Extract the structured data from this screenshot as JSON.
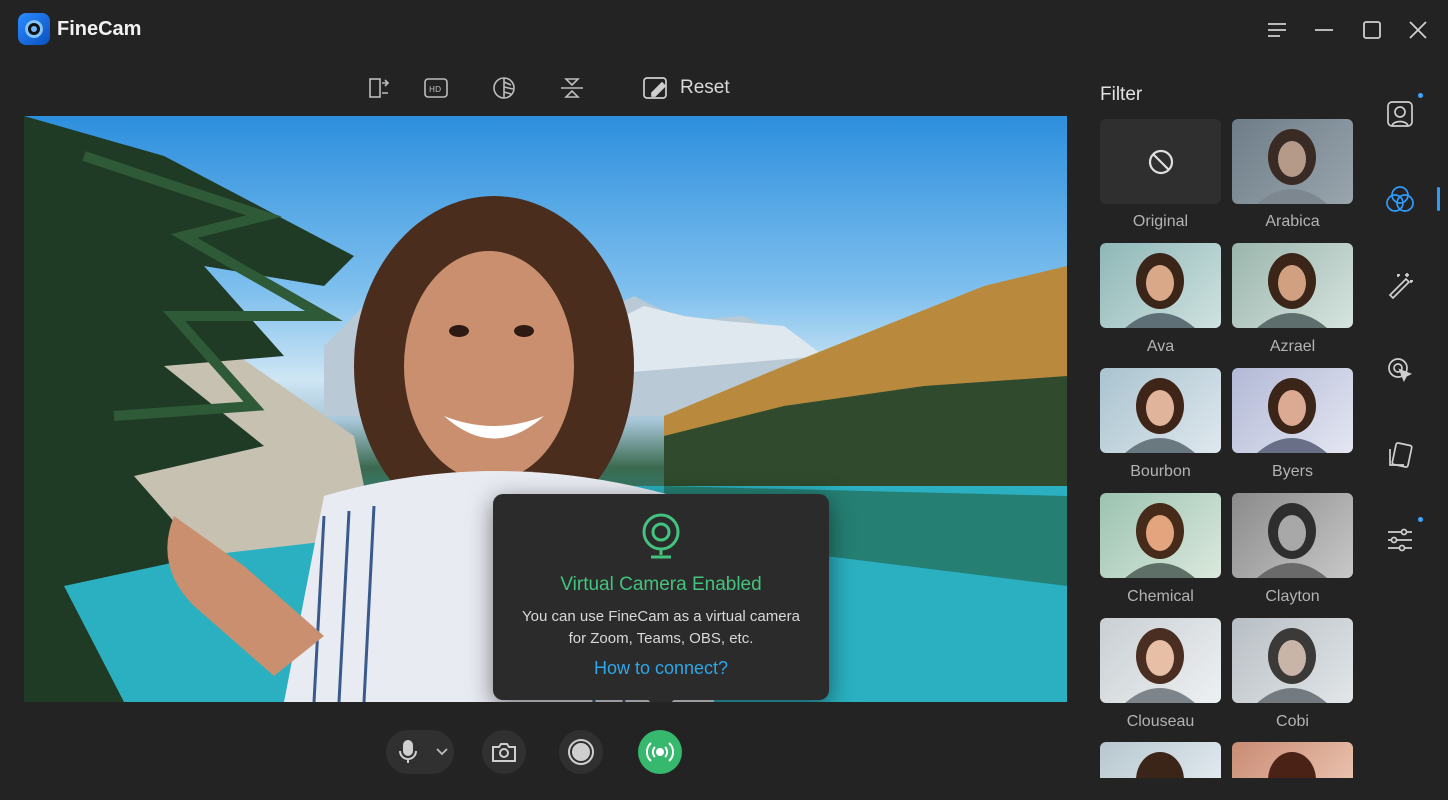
{
  "app": {
    "title": "FineCam"
  },
  "toolbar": {
    "reset_label": "Reset",
    "icons": [
      "mirror-icon",
      "hd-icon",
      "contrast-icon",
      "flip-icon",
      "reset-icon"
    ]
  },
  "popup": {
    "title": "Virtual Camera Enabled",
    "line1": "You can use FineCam as a virtual camera",
    "line2": "for Zoom, Teams, OBS, etc.",
    "link": "How to connect?"
  },
  "filter": {
    "title": "Filter",
    "items": [
      {
        "label": "Original"
      },
      {
        "label": "Arabica"
      },
      {
        "label": "Ava"
      },
      {
        "label": "Azrael"
      },
      {
        "label": "Bourbon"
      },
      {
        "label": "Byers"
      },
      {
        "label": "Chemical"
      },
      {
        "label": "Clayton"
      },
      {
        "label": "Clouseau"
      },
      {
        "label": "Cobi"
      }
    ]
  },
  "colors": {
    "accent": "#36b86e",
    "link": "#2ea7e8",
    "active": "#2f9bff"
  }
}
